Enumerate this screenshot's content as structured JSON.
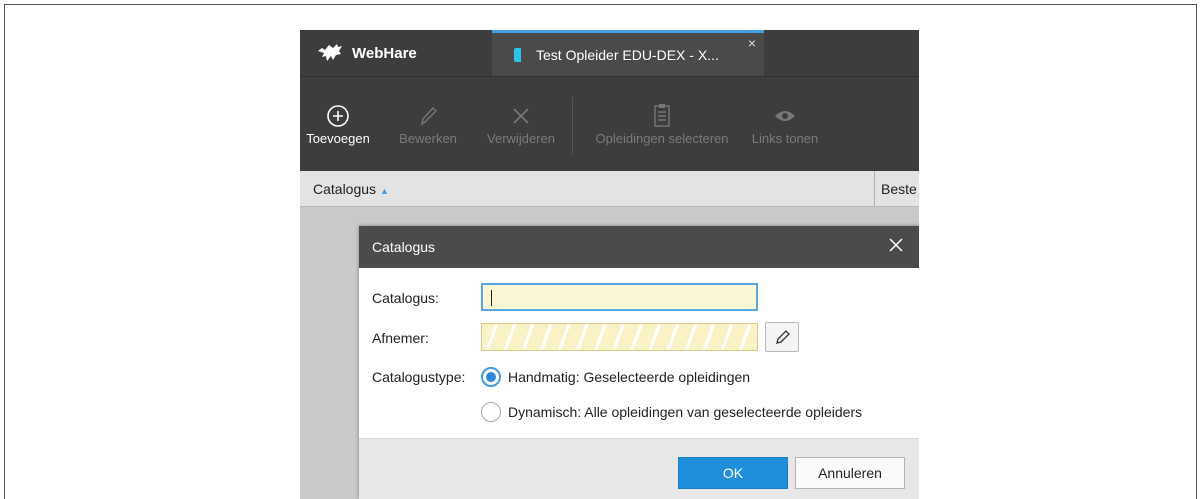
{
  "app": {
    "brand": "WebHare",
    "tab": {
      "title": "Test Opleider EDU-DEX - X...",
      "close": "×"
    }
  },
  "toolbar": {
    "items": [
      {
        "label": "Toevoegen",
        "icon": "add-circle-icon",
        "enabled": true
      },
      {
        "label": "Bewerken",
        "icon": "pencil-icon",
        "enabled": false
      },
      {
        "label": "Verwijderen",
        "icon": "close-icon",
        "enabled": false
      },
      {
        "label": "Opleidingen selecteren",
        "icon": "clipboard-list-icon",
        "enabled": false
      },
      {
        "label": "Links tonen",
        "icon": "eye-icon",
        "enabled": false
      }
    ]
  },
  "list": {
    "columns": [
      {
        "label": "Catalogus",
        "sort": "asc"
      },
      {
        "label": "Beste"
      }
    ]
  },
  "dialog": {
    "title": "Catalogus",
    "fields": {
      "catalogus_label": "Catalogus:",
      "catalogus_value": "",
      "afnemer_label": "Afnemer:",
      "afnemer_value": "",
      "type_label": "Catalogustype:"
    },
    "options": [
      {
        "label": "Handmatig: Geselecteerde opleidingen",
        "checked": true
      },
      {
        "label": "Dynamisch: Alle opleidingen van geselecteerde opleiders",
        "checked": false
      }
    ],
    "buttons": {
      "ok": "OK",
      "cancel": "Annuleren"
    }
  },
  "colors": {
    "accent": "#1f8fdc",
    "topbar": "#3d3d3d",
    "dialog_header": "#4b4b4b",
    "field_bg": "#fbf7d5",
    "tab_icon": "#29c5e8"
  }
}
